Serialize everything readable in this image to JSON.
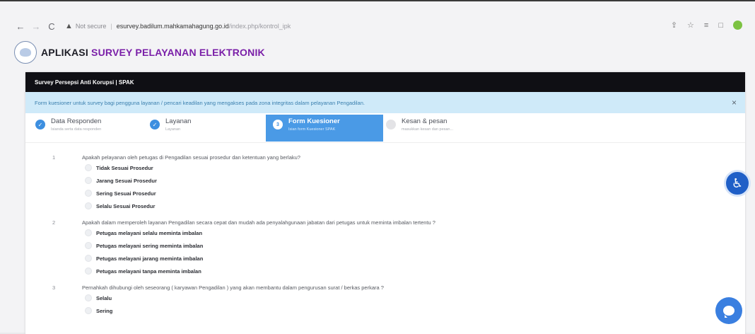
{
  "browser": {
    "back_icon": "←",
    "forward_icon": "→",
    "reload_icon": "C",
    "warning_icon": "▲",
    "not_secure": "Not secure",
    "separator": "|",
    "url_host": "esurvey.badilum.mahkamahagung.go.id",
    "url_path": "/index.php/kontrol_ipk",
    "share_icon": "⇪",
    "star_icon": "☆",
    "readlist_icon": "≡",
    "tab_icon": "□"
  },
  "app": {
    "title_prefix": "APLIKASI",
    "title_accent": "SURVEY PELAYANAN ELEKTRONIK",
    "accent_color": "#7a1fa8"
  },
  "card": {
    "header": "Survey Persepsi Anti Korupsi | SPAK",
    "alert_text": "Form kuesioner untuk survey bagi pengguna layanan / pencari keadilan yang mengakses pada zona integritas dalam pelayanan Pengadilan.",
    "alert_close": "×"
  },
  "steps": [
    {
      "title": "Data Responden",
      "sub": "Isianda serta data responden",
      "state": "done",
      "icon": "✓"
    },
    {
      "title": "Layanan",
      "sub": "Layanan",
      "state": "done",
      "icon": "✓"
    },
    {
      "title": "Form Kuesioner",
      "sub": "Isian form Kuesioner SPAK",
      "state": "current",
      "icon": "3"
    },
    {
      "title": "Kesan & pesan",
      "sub": "masukkan kesan dan pesan...",
      "state": "todo",
      "icon": ""
    }
  ],
  "questions": [
    {
      "number": "1",
      "text": "Apakah pelayanan oleh petugas di Pengadilan sesuai prosedur dan ketentuan yang berlaku?",
      "options": [
        "Tidak Sesuai Prosedur",
        "Jarang Sesuai Prosedur",
        "Sering Sesuai Prosedur",
        "Selalu Sesuai Prosedur"
      ]
    },
    {
      "number": "2",
      "text": "Apakah dalam memperoleh layanan Pengadilan secara cepat dan mudah ada penyalahgunaan jabatan dari petugas untuk meminta imbalan tertentu ?",
      "options": [
        "Petugas melayani selalu meminta imbalan",
        "Petugas melayani sering meminta imbalan",
        "Petugas melayani jarang meminta imbalan",
        "Petugas melayani tanpa meminta imbalan"
      ]
    },
    {
      "number": "3",
      "text": "Pernahkah dihubungi oleh seseorang ( karyawan Pengadilan ) yang akan membantu dalam pengurusan surat / berkas perkara ?",
      "options": [
        "Selalu",
        "Sering"
      ]
    }
  ],
  "floating": {
    "accessibility_icon": "♿",
    "chat_icon": "chat-icon"
  }
}
